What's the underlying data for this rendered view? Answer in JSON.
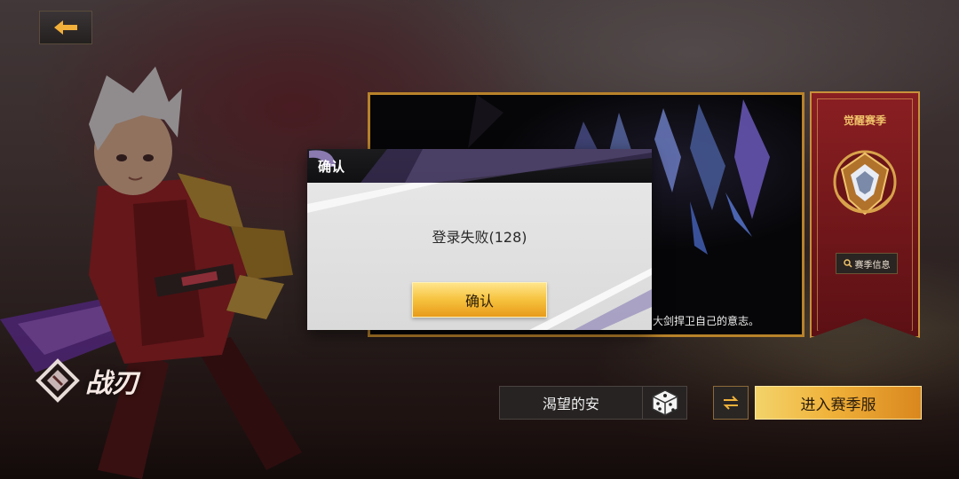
{
  "class": {
    "name": "战刃"
  },
  "video": {
    "caption": "大剑捍卫自己的意志。"
  },
  "season": {
    "title": "觉醒赛季",
    "info_button": "赛季信息"
  },
  "player": {
    "name": "渴望的安"
  },
  "actions": {
    "enter_season_server": "进入赛季服"
  },
  "dialog": {
    "title": "确认",
    "message": "登录失败(128)",
    "confirm_label": "确认"
  },
  "icons": {
    "back": "back-arrow-icon",
    "search": "search-icon",
    "dice": "dice-icon",
    "swap": "swap-icon",
    "class_logo": "class-emblem-icon"
  },
  "colors": {
    "accent_gold": "#f0b23a",
    "banner_red": "#8a1f22",
    "panel_border": "#b8822a"
  }
}
